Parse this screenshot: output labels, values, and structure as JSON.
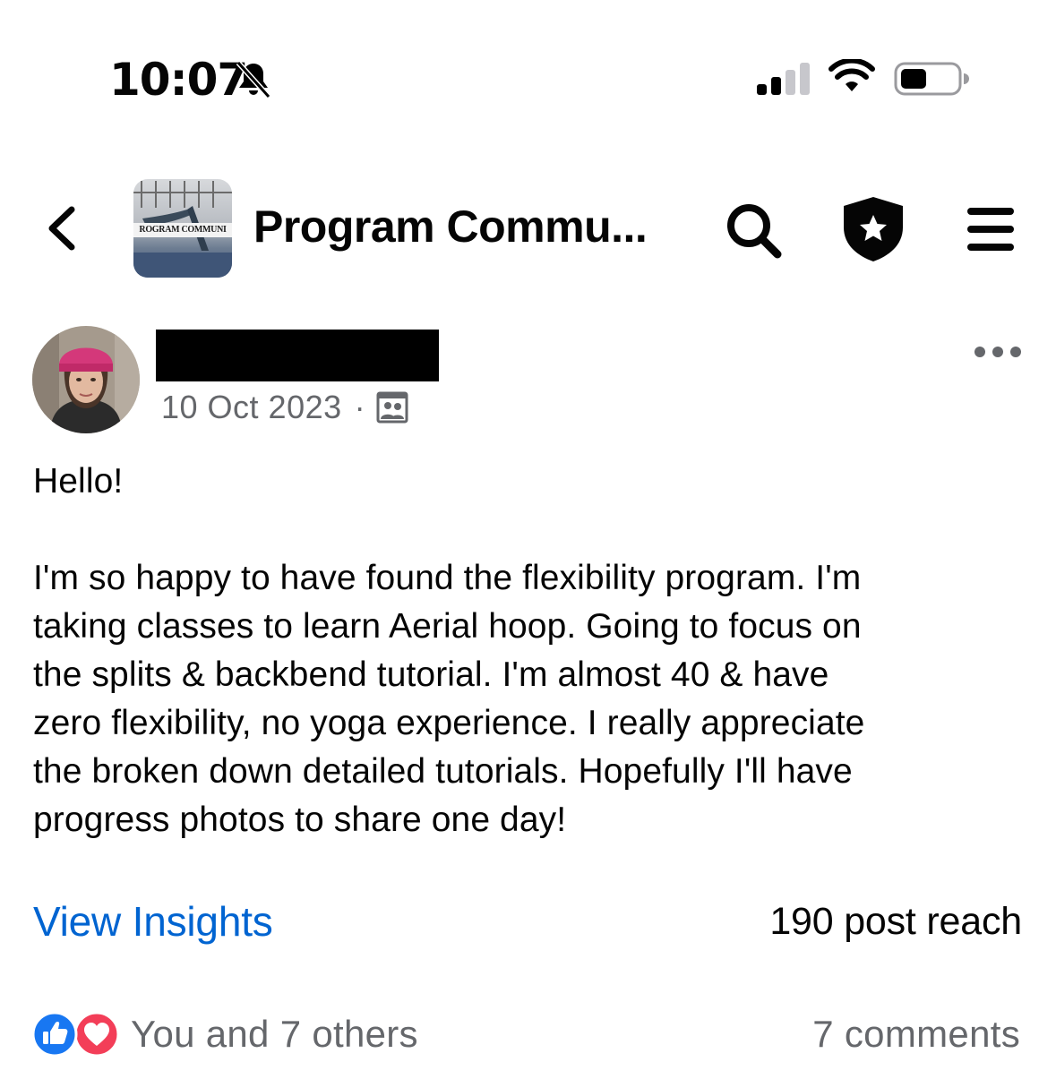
{
  "status_bar": {
    "time": "10:07",
    "icons": [
      "bell-slash-icon",
      "cellular-signal-icon",
      "wifi-icon",
      "battery-icon"
    ]
  },
  "header": {
    "back_icon": "chevron-left-icon",
    "group_thumbnail_label": "ROGRAM COMMUNI",
    "title": "Program Commu...",
    "actions": [
      "search-icon",
      "admin-shield-star-icon",
      "hamburger-menu-icon"
    ]
  },
  "post": {
    "author_name": "",
    "date": "10 Oct 2023",
    "separator": "·",
    "audience_icon": "group-members-icon",
    "more_icon": "more-horizontal-icon",
    "greeting": "Hello!",
    "body": "I'm so happy to have found the flexibility program. I'm\ntaking classes to learn Aerial hoop. Going to focus on\nthe splits & backbend tutorial. I'm almost 40 & have\nzero flexibility, no yoga experience. I really appreciate\nthe broken down detailed tutorials. Hopefully I'll have\nprogress photos to share one day!",
    "insights_label": "View Insights",
    "reach": "190 post reach",
    "reaction_icons": [
      "like-icon",
      "love-icon"
    ],
    "reactions_summary": "You and 7 others",
    "comments": "7 comments"
  },
  "colors": {
    "link_blue": "#0064d1",
    "secondary_text": "#65676b",
    "like_blue": "#1877f2",
    "love_red": "#f33e58"
  }
}
